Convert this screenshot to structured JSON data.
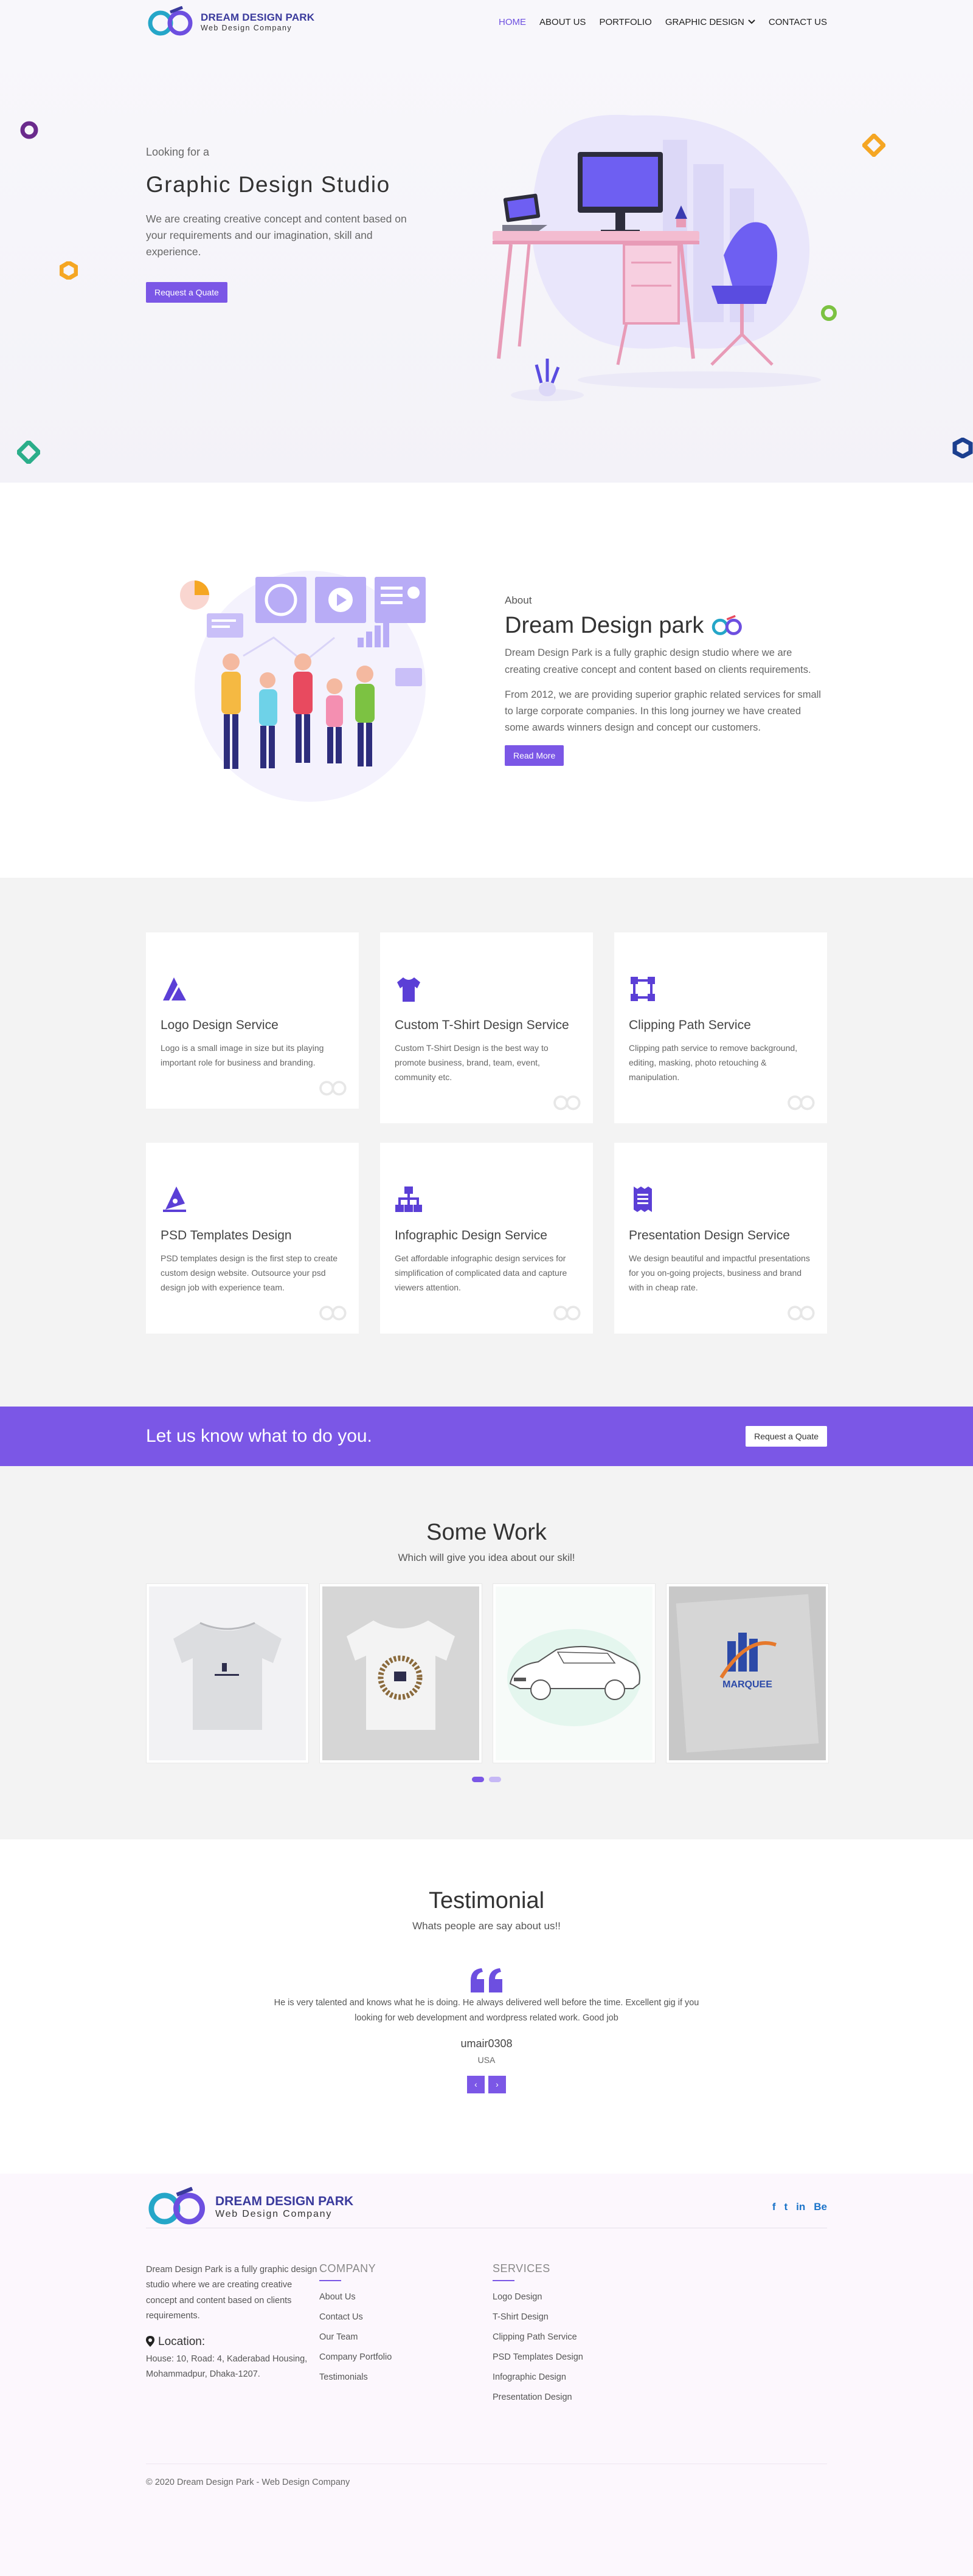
{
  "brand": {
    "name": "DREAM DESIGN PARK",
    "tagline": "Web Design Company",
    "colors": {
      "accent": "#7b57e6",
      "brand_blue": "#3a3a9c",
      "logo_teal": "#25a6c8",
      "logo_purple": "#6d4fe0"
    }
  },
  "nav": {
    "items": [
      {
        "label": "HOME",
        "active": true
      },
      {
        "label": "ABOUT US"
      },
      {
        "label": "PORTFOLIO"
      },
      {
        "label": "GRAPHIC DESIGN",
        "icon": "chevron-down-icon"
      },
      {
        "label": "CONTACT US"
      }
    ]
  },
  "hero": {
    "pretitle": "Looking for a",
    "title": "Graphic Design Studio",
    "text": "We are creating creative concept and content based on your requirements and our imagination, skill and experience.",
    "button": "Request a Quate"
  },
  "about": {
    "pretitle": "About",
    "title": "Dream Design park",
    "p1": "Dream Design Park is a fully graphic design studio where we are creating creative concept and content based on clients requirements.",
    "p2": "From 2012, we are providing superior graphic related services for small to large corporate companies. In this long journey we have created some awards winners design and concept our customers.",
    "button": "Read More"
  },
  "services": [
    {
      "icon": "logo-design-icon",
      "title": "Logo Design Service",
      "text": "Logo is a small image in size but its playing important role for business and branding."
    },
    {
      "icon": "tshirt-icon",
      "title": "Custom T-Shirt Design Service",
      "text": "Custom T-Shirt Design is the best way to promote business, brand, team, event, community etc."
    },
    {
      "icon": "clipping-path-icon",
      "title": "Clipping Path Service",
      "text": "Clipping path service to remove background, editing, masking, photo retouching & manipulation."
    },
    {
      "icon": "pen-tool-icon",
      "title": "PSD Templates Design",
      "text": "PSD templates design is the first step to create custom design website. Outsource your psd design job with experience team."
    },
    {
      "icon": "hierarchy-icon",
      "title": "Infographic Design Service",
      "text": "Get affordable infographic design services for simplification of complicated data and capture viewers attention."
    },
    {
      "icon": "receipt-icon",
      "title": "Presentation Design Service",
      "text": "We design beautiful and impactful presentations for you on-going projects, business and brand with in cheap rate."
    }
  ],
  "cta": {
    "text": "Let us know what to do you.",
    "button": "Request a Quate"
  },
  "work": {
    "title": "Some Work",
    "subtitle": "Which will give you idea about our skil!",
    "items": [
      {
        "kind": "tshirt",
        "caption": ""
      },
      {
        "kind": "tshirt-ring",
        "caption": ""
      },
      {
        "kind": "car",
        "caption": ""
      },
      {
        "kind": "logo-paper",
        "caption": "MARQUEE"
      }
    ],
    "page": 1,
    "pages": 2
  },
  "testimonial": {
    "title": "Testimonial",
    "subtitle": "Whats people are say about us!!",
    "message": "He is very talented and knows what he is doing. He always delivered well before the time. Excellent gig if you looking for web development and wordpress related work. Good job",
    "name": "umair0308",
    "location": "USA",
    "prev": "‹",
    "next": "›"
  },
  "footer": {
    "about": "Dream Design Park is a fully graphic design studio where we are creating creative concept and content based on clients requirements.",
    "location_heading": "Location:",
    "address": "House: 10, Road: 4, Kaderabad Housing, Mohammadpur, Dhaka-1207.",
    "social": [
      "f",
      "t",
      "in",
      "Be"
    ],
    "company_heading": "COMPANY",
    "company_links": [
      "About Us",
      "Contact Us",
      "Our Team",
      "Company Portfolio",
      "Testimonials"
    ],
    "services_heading": "SERVICES",
    "service_links": [
      "Logo Design",
      "T-Shirt Design",
      "Clipping Path Service",
      "PSD Templates Design",
      "Infographic Design",
      "Presentation Design"
    ],
    "copyright": "© 2020 Dream Design Park - Web Design Company"
  }
}
